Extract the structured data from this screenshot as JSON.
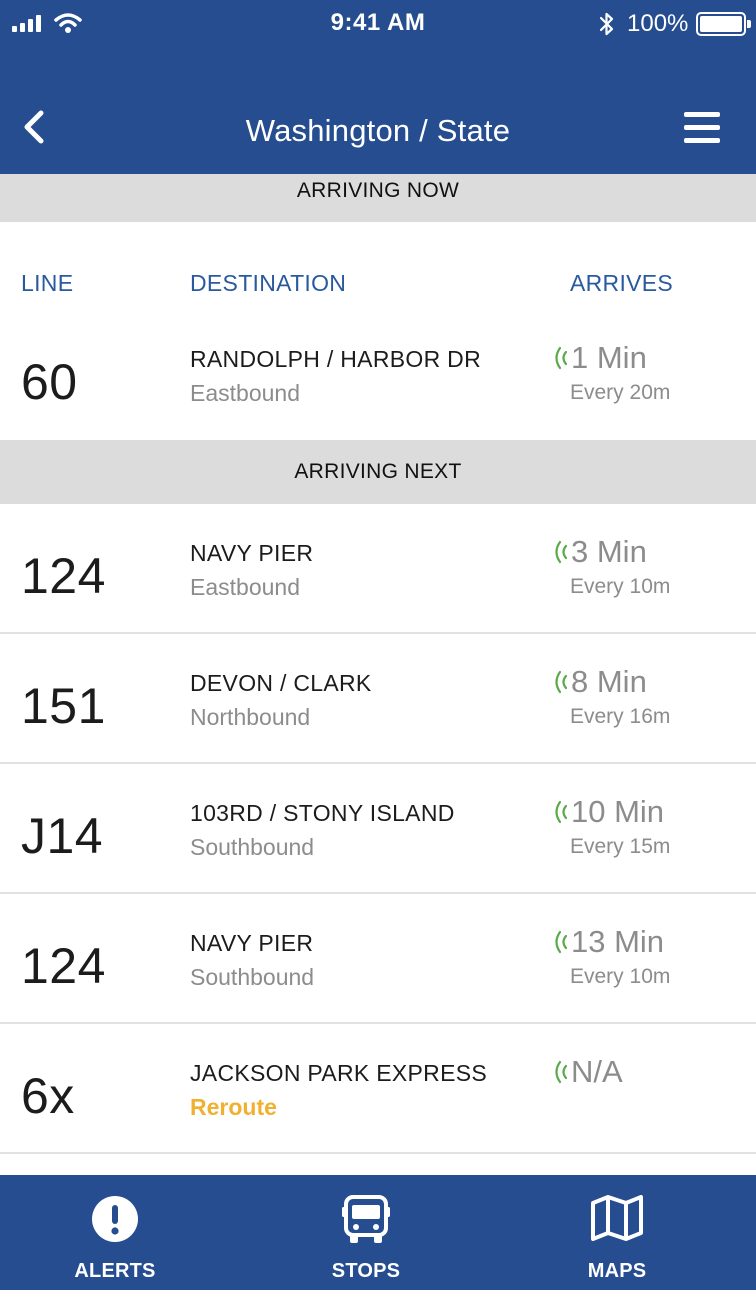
{
  "status_bar": {
    "time": "9:41 AM",
    "battery": "100%"
  },
  "header": {
    "title": "Washington / State"
  },
  "sections": {
    "now": "ARRIVING NOW",
    "next": "ARRIVING NEXT"
  },
  "columns": {
    "line": "LINE",
    "destination": "DESTINATION",
    "arrives": "ARRIVES"
  },
  "arrivals": [
    {
      "line": "60",
      "destination": "RANDOLPH / HARBOR DR",
      "direction": "Eastbound",
      "arrives": "1 Min",
      "frequency": "Every 20m"
    },
    {
      "line": "124",
      "destination": "NAVY PIER",
      "direction": "Eastbound",
      "arrives": "3 Min",
      "frequency": "Every 10m"
    },
    {
      "line": "151",
      "destination": "DEVON / CLARK",
      "direction": "Northbound",
      "arrives": "8 Min",
      "frequency": "Every 16m"
    },
    {
      "line": "J14",
      "destination": "103RD / STONY ISLAND",
      "direction": "Southbound",
      "arrives": "10 Min",
      "frequency": "Every 15m"
    },
    {
      "line": "124",
      "destination": "NAVY PIER",
      "direction": "Southbound",
      "arrives": "13 Min",
      "frequency": "Every 10m"
    },
    {
      "line": "6x",
      "destination": "JACKSON PARK EXPRESS",
      "direction": "Reroute",
      "arrives": "N/A",
      "frequency": ""
    }
  ],
  "tabs": [
    {
      "label": "ALERTS",
      "icon": "alert-icon"
    },
    {
      "label": "STOPS",
      "icon": "bus-icon"
    },
    {
      "label": "MAPS",
      "icon": "map-icon"
    }
  ],
  "colors": {
    "primary": "#254d8f",
    "section_band": "#dcdcdc",
    "realtime": "#5aaa4a",
    "reroute": "#f2b030",
    "secondary_text": "#8c8c8c"
  }
}
